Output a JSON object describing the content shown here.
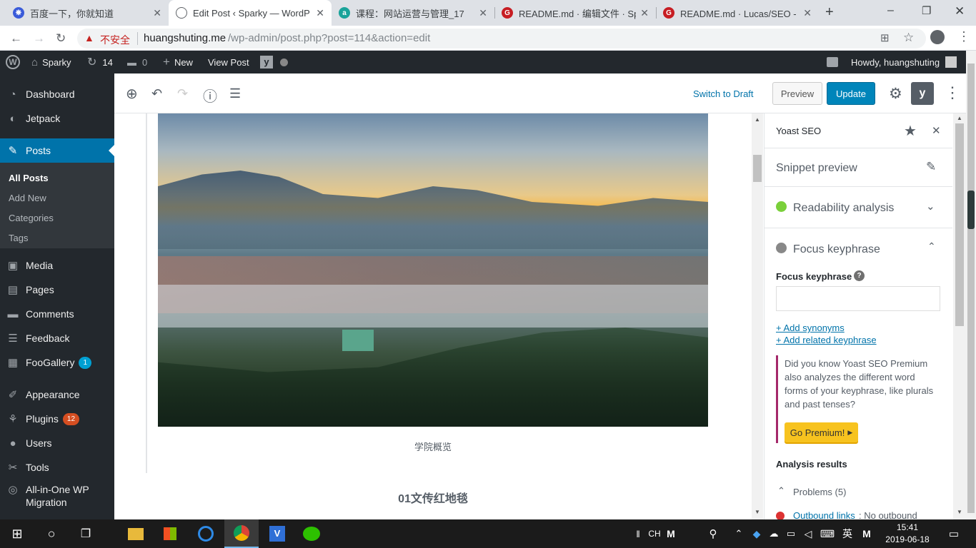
{
  "browser": {
    "tabs": [
      {
        "title": "百度一下，你就知道",
        "color": "#3a5bd9",
        "glyph": "❋"
      },
      {
        "title": "Edit Post ‹ Sparky — WordP",
        "color": "#5f6368",
        "glyph": "⊕"
      },
      {
        "title": "课程：网站运营与管理_17",
        "color": "#1aa39a",
        "glyph": "a"
      },
      {
        "title": "README.md · 编辑文件 · Spa",
        "color": "#c71d23",
        "glyph": "G"
      },
      {
        "title": "README.md · Lucas/SEO - 码",
        "color": "#c71d23",
        "glyph": "G"
      }
    ],
    "new_tab_icon": "+",
    "address": {
      "security_label": "不安全",
      "host": "huangshuting.me",
      "path": "/wp-admin/post.php?post=114&action=edit"
    }
  },
  "adminbar": {
    "site_name": "Sparky",
    "updates_count": "14",
    "comments_count": "0",
    "new_label": "New",
    "view_post_label": "View Post",
    "howdy": "Howdy, huangshuting"
  },
  "sidebar": {
    "items": [
      {
        "label": "Dashboard",
        "icon": "dashboard-icon",
        "glyph": "◔"
      },
      {
        "label": "Jetpack",
        "icon": "jetpack-icon",
        "glyph": "◐"
      },
      {
        "label": "Posts",
        "icon": "pin-icon",
        "glyph": "✎"
      },
      {
        "label": "Media",
        "icon": "media-icon",
        "glyph": "▣"
      },
      {
        "label": "Pages",
        "icon": "pages-icon",
        "glyph": "▤"
      },
      {
        "label": "Comments",
        "icon": "comments-icon",
        "glyph": "▬"
      },
      {
        "label": "Feedback",
        "icon": "feedback-icon",
        "glyph": "☰"
      },
      {
        "label": "FooGallery",
        "icon": "gallery-icon",
        "glyph": "▦",
        "badge": "1"
      },
      {
        "label": "Appearance",
        "icon": "brush-icon",
        "glyph": "✐"
      },
      {
        "label": "Plugins",
        "icon": "plugin-icon",
        "glyph": "⚘",
        "badge": "12"
      },
      {
        "label": "Users",
        "icon": "users-icon",
        "glyph": "●"
      },
      {
        "label": "Tools",
        "icon": "wrench-icon",
        "glyph": "✂"
      },
      {
        "label": "All-in-One WP Migration",
        "icon": "migration-icon",
        "glyph": "◎"
      }
    ],
    "posts_sub": [
      "All Posts",
      "Add New",
      "Categories",
      "Tags"
    ]
  },
  "toolbar": {
    "switch_draft": "Switch to Draft",
    "preview": "Preview",
    "update": "Update"
  },
  "content": {
    "caption": "学院概览",
    "heading": "01文传红地毯"
  },
  "yoast": {
    "title": "Yoast SEO",
    "snippet_preview": "Snippet preview",
    "readability": "Readability analysis",
    "focus_section": "Focus keyphrase",
    "focus_label": "Focus keyphrase",
    "add_synonyms": "+ Add synonyms",
    "add_related": "+ Add related keyphrase",
    "premium_text": "Did you know Yoast SEO Premium also analyzes the different word forms of your keyphrase, like plurals and past tenses?",
    "go_premium": "Go Premium!",
    "analysis_results": "Analysis results",
    "problems": "Problems (5)",
    "outbound_link": "Outbound links",
    "outbound_rest": ": No outbound"
  },
  "taskbar": {
    "ime1": "CH",
    "ime2": "英",
    "time": "15:41",
    "date": "2019-06-18"
  }
}
